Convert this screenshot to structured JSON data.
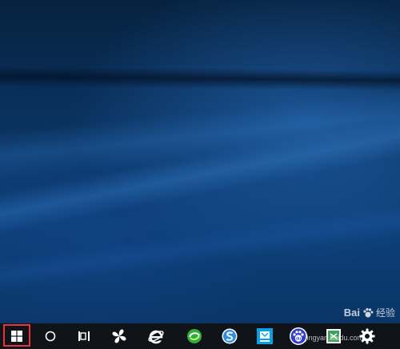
{
  "desktop": {
    "wallpaper": "windows-10-blue-light-beams"
  },
  "taskbar": {
    "background": "#101418",
    "highlight_color": "#e8343a",
    "items": [
      {
        "name": "start-button",
        "icon": "windows-logo-icon"
      },
      {
        "name": "cortana-search-button",
        "icon": "circle-icon"
      },
      {
        "name": "task-view-button",
        "icon": "task-view-icon"
      },
      {
        "name": "pinwheel-app-button",
        "icon": "pinwheel-icon"
      },
      {
        "name": "internet-explorer-button",
        "icon": "ie-icon"
      },
      {
        "name": "green-browser-button",
        "icon": "green-swirl-icon"
      },
      {
        "name": "blue-s-app-button",
        "icon": "blue-s-icon"
      },
      {
        "name": "blue-square-app-button",
        "icon": "blue-square-icon"
      },
      {
        "name": "baidu-button",
        "icon": "baidu-paw-icon"
      },
      {
        "name": "green-doc-app-button",
        "icon": "green-doc-icon"
      },
      {
        "name": "settings-button",
        "icon": "gear-icon"
      }
    ]
  },
  "watermark": {
    "logo_text": "Bai",
    "logo_suffix": "经验",
    "url": "jingyan.baidu.com"
  }
}
